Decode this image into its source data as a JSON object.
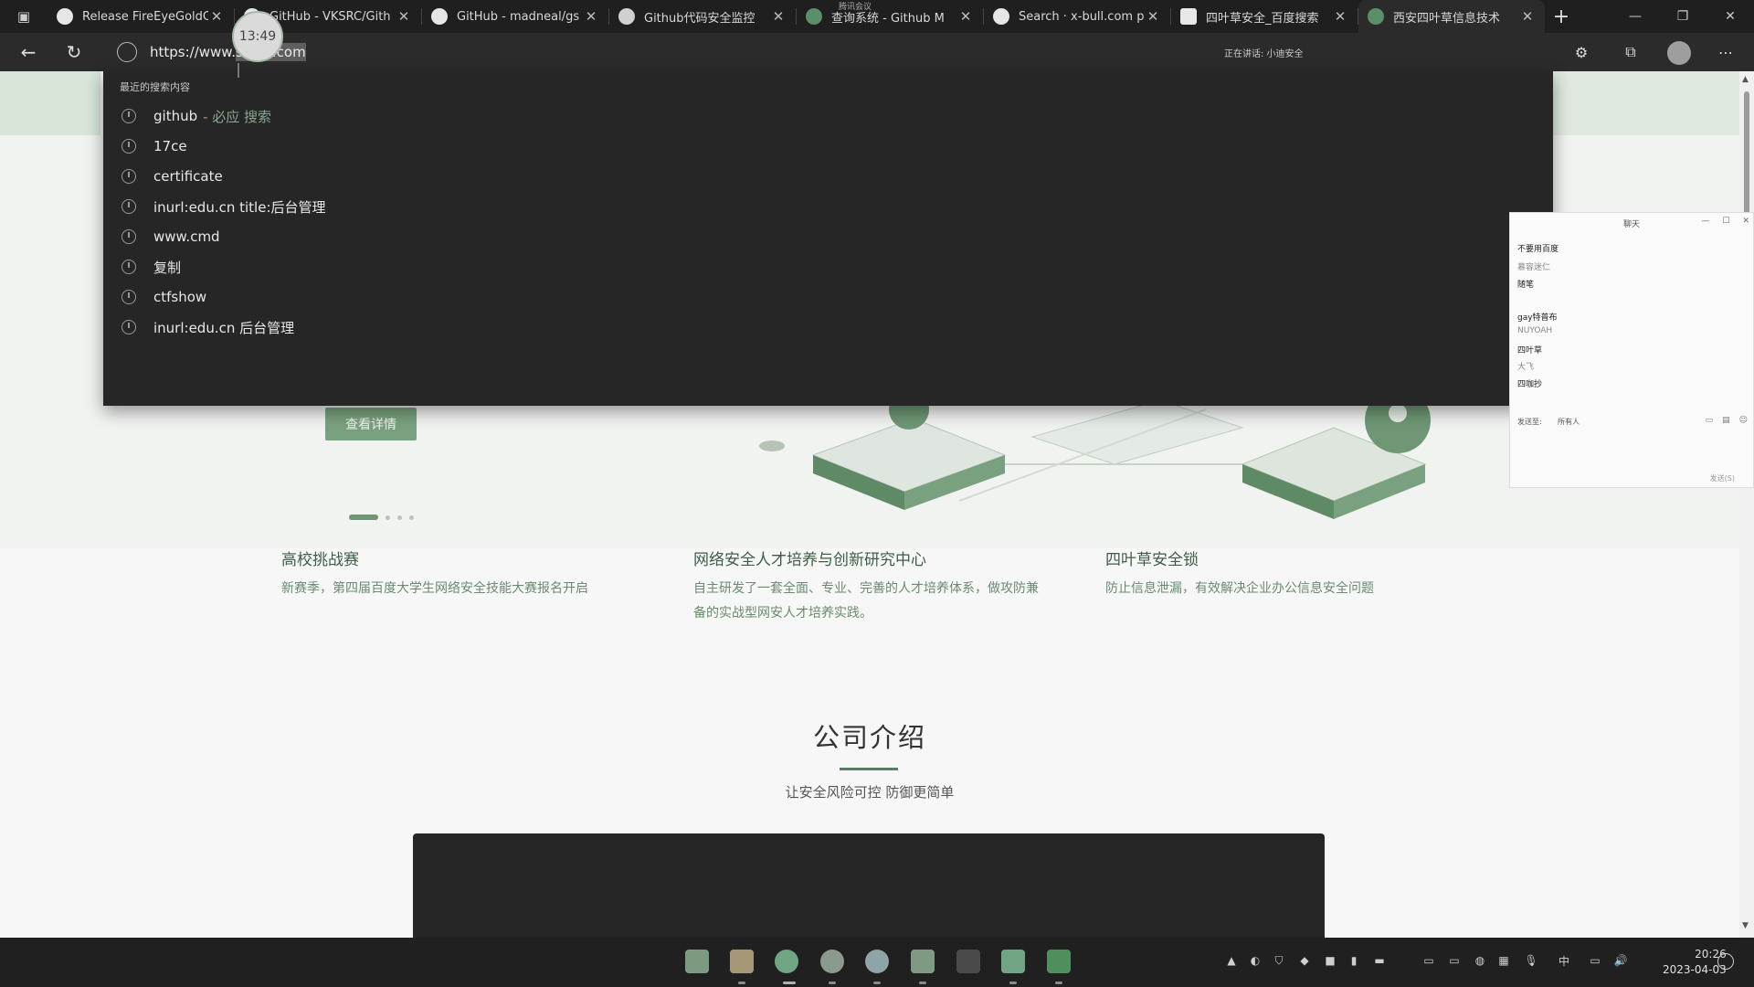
{
  "browser": {
    "tabs": [
      {
        "title": "Release FireEyeGoldC",
        "icon": "github-icon",
        "active": false
      },
      {
        "title": "GitHub - VKSRC/Gith",
        "icon": "github-icon",
        "active": false
      },
      {
        "title": "GitHub - madneal/gs",
        "icon": "github-icon",
        "active": false
      },
      {
        "title": "Github代码安全监控",
        "icon": "wordpress-icon",
        "active": false
      },
      {
        "title": "查询系统 - Github M",
        "icon": "site-icon",
        "active": false
      },
      {
        "title": "Search · x-bull.com p",
        "icon": "github-icon",
        "active": false
      },
      {
        "title": "四叶草安全_百度搜索",
        "icon": "baidu-icon",
        "active": false
      },
      {
        "title": "西安四叶草信息技术",
        "icon": "site-icon",
        "active": true
      }
    ],
    "new_tab_label": "+",
    "address": {
      "url_prefix": "https://www.",
      "url_selected": "se",
      "url_hidden": "ver.com",
      "url_tail": "com"
    },
    "speaking_text": "正在讲话: 小迪安全",
    "meeting_banner": "腾讯会议"
  },
  "recording": {
    "time": "13:49"
  },
  "suggestions": {
    "header": "最近的搜索内容",
    "items": [
      {
        "text": "github",
        "suffix": "- 必应 搜索"
      },
      {
        "text": "17ce",
        "suffix": ""
      },
      {
        "text": "certificate",
        "suffix": ""
      },
      {
        "text": "inurl:edu.cn title:后台管理",
        "suffix": ""
      },
      {
        "text": "www.cmd",
        "suffix": ""
      },
      {
        "text": "复制",
        "suffix": ""
      },
      {
        "text": "ctfshow",
        "suffix": ""
      },
      {
        "text": "inurl:edu.cn 后台管理",
        "suffix": ""
      }
    ]
  },
  "page": {
    "hero_button": "查看详情",
    "features": [
      {
        "title": "高校挑战赛",
        "desc": "新赛季，第四届百度大学生网络安全技能大赛报名开启"
      },
      {
        "title": "网络安全人才培养与创新研究中心",
        "desc": "自主研发了一套全面、专业、完善的人才培养体系，做攻防兼备的实战型网安人才培养实践。"
      },
      {
        "title": "四叶草安全锁",
        "desc": "防止信息泄漏，有效解决企业办公信息安全问题"
      }
    ],
    "company_title": "公司介绍",
    "company_subtitle": "让安全风险可控 防御更简单"
  },
  "chat": {
    "title": "聊天",
    "lines": [
      {
        "text": "不要用百度",
        "dim": false
      },
      {
        "text": "慕容迷仁",
        "dim": true
      },
      {
        "text": "随笔",
        "dim": false
      },
      {
        "text": "gay特普布",
        "dim": false
      },
      {
        "text": "NUYOAH",
        "dim": true
      },
      {
        "text": "四叶草",
        "dim": false
      },
      {
        "text": "大飞",
        "dim": true
      },
      {
        "text": "四咖抄",
        "dim": false
      }
    ],
    "send_to_label": "发送至:",
    "recipient": "所有人",
    "send_label": "发送(S)"
  },
  "taskbar": {
    "clock_time": "20:26",
    "clock_date": "2023-04-03",
    "ime": "中"
  },
  "colors": {
    "accent_green": "#6f9775",
    "dark_bg": "#262626"
  }
}
